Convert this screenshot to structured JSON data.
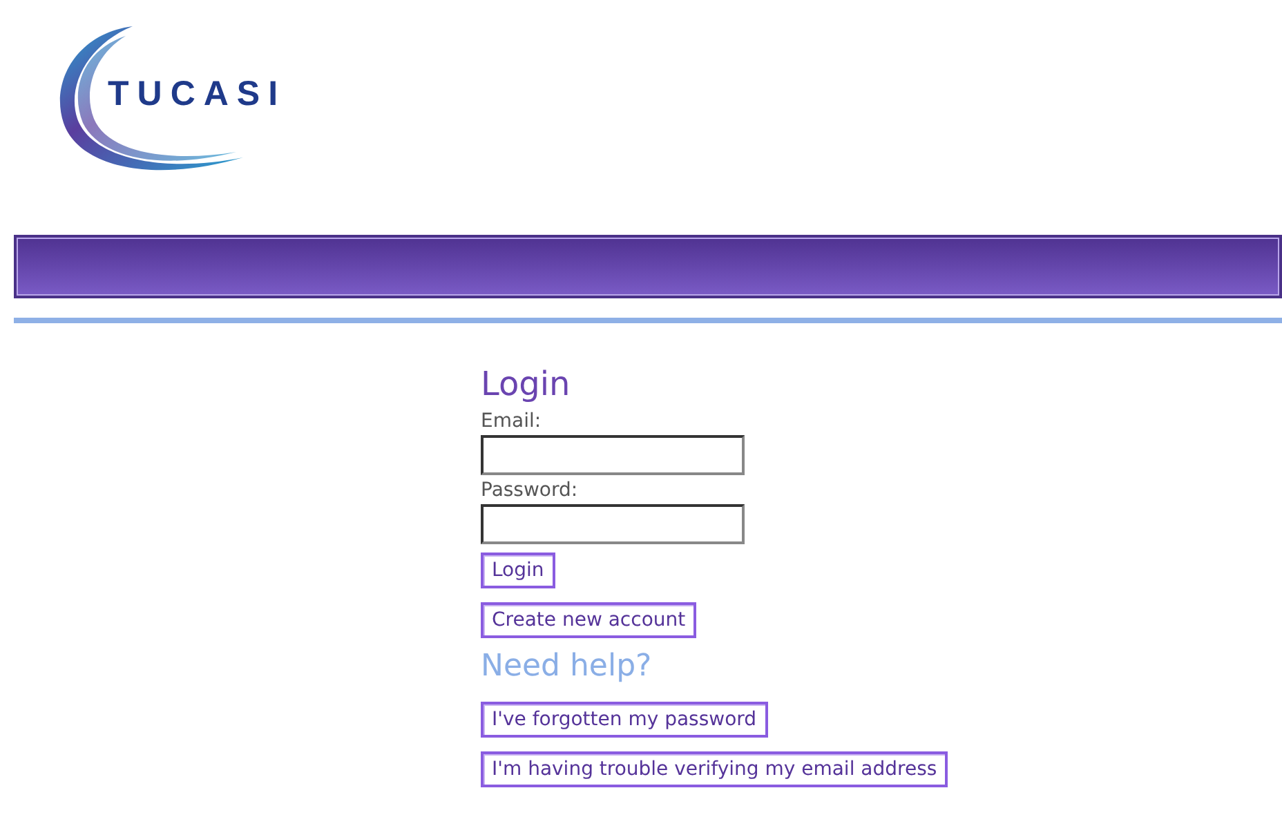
{
  "logo": {
    "text": "TUCASI"
  },
  "login": {
    "title": "Login",
    "fields": [
      {
        "label": "Email:"
      },
      {
        "label": "Password:"
      }
    ],
    "login_button": "Login",
    "create_button": "Create new account"
  },
  "help": {
    "title": "Need help?",
    "buttons": [
      "I've forgotten my password",
      "I'm having trouble verifying my email address"
    ]
  }
}
